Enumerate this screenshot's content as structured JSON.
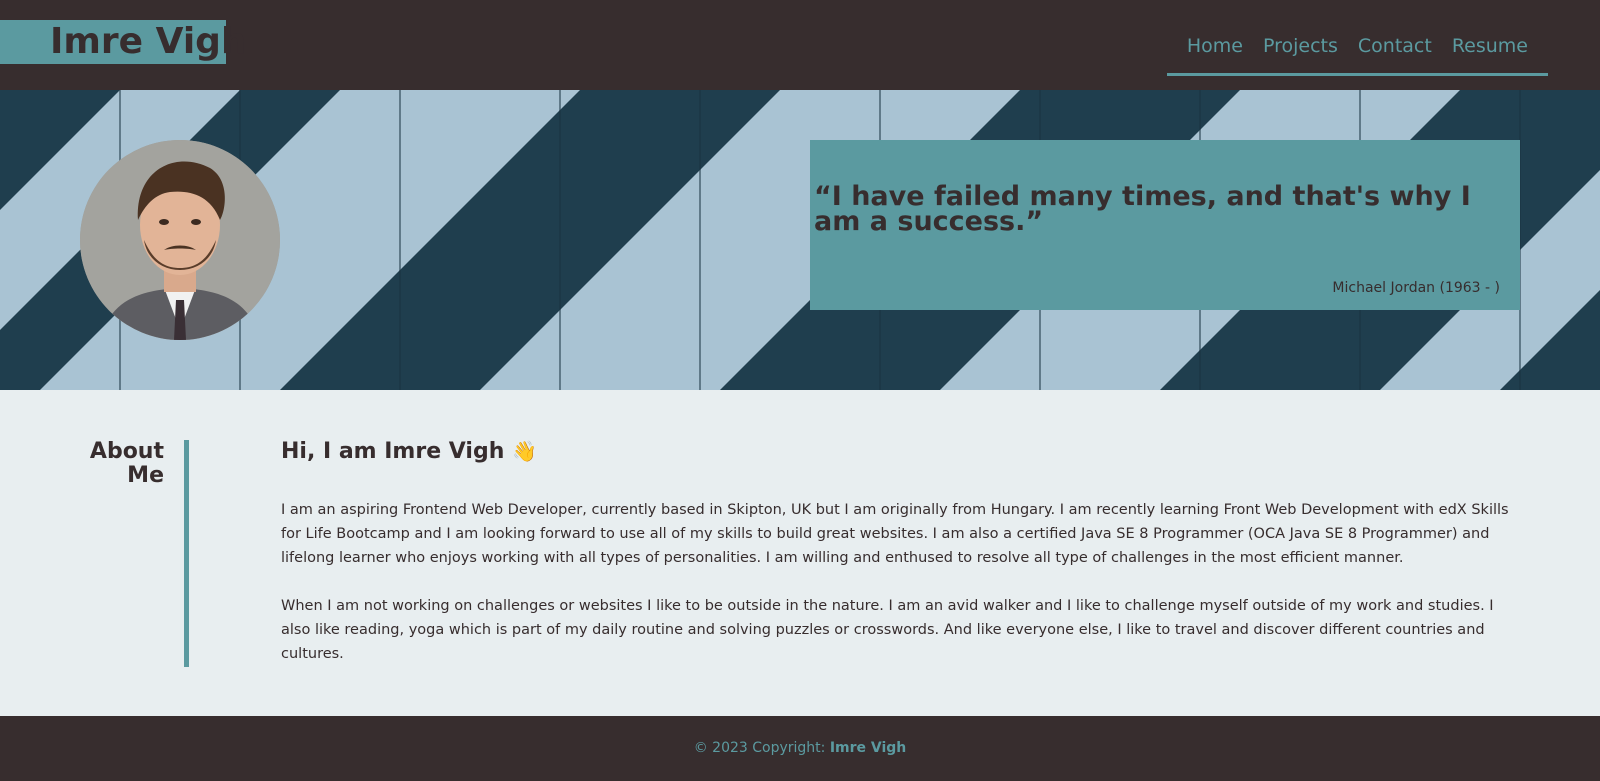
{
  "header": {
    "brand": "Imre Vigh",
    "nav": [
      {
        "label": "Home"
      },
      {
        "label": "Projects"
      },
      {
        "label": "Contact"
      },
      {
        "label": "Resume"
      }
    ]
  },
  "hero": {
    "quote": "“I have failed many times, and that's why I am a success.”",
    "author": "Michael Jordan (1963 - )"
  },
  "about": {
    "heading": "About Me",
    "greeting": "Hi, I am Imre Vigh",
    "paragraphs": [
      "I am an aspiring Frontend Web Developer, currently based in Skipton, UK but I am originally from Hungary. I am recently learning Front Web Development with edX Skills for Life Bootcamp and I am looking forward to use all of my skills to build great websites. I am also a certified Java SE 8 Programmer (OCA Java SE 8 Programmer) and lifelong learner who enjoys working with all types of personalities. I am willing and enthused to resolve all type of challenges in the most efficient manner.",
      "When I am not working on challenges or websites I like to be outside in the nature. I am an avid walker and I like to challenge myself outside of my work and studies. I also like reading, yoga which is part of my daily routine and solving puzzles or crosswords. And like everyone else, I like to travel and discover different countries and cultures."
    ]
  },
  "footer": {
    "prefix": "© 2023 Copyright: ",
    "name": "Imre Vigh"
  },
  "colors": {
    "dark": "#372d2e",
    "teal": "#5b9aa0",
    "light": "#e8eef0",
    "stripe_dark": "#1f3e4e",
    "stripe_light": "#a9c3d3"
  }
}
